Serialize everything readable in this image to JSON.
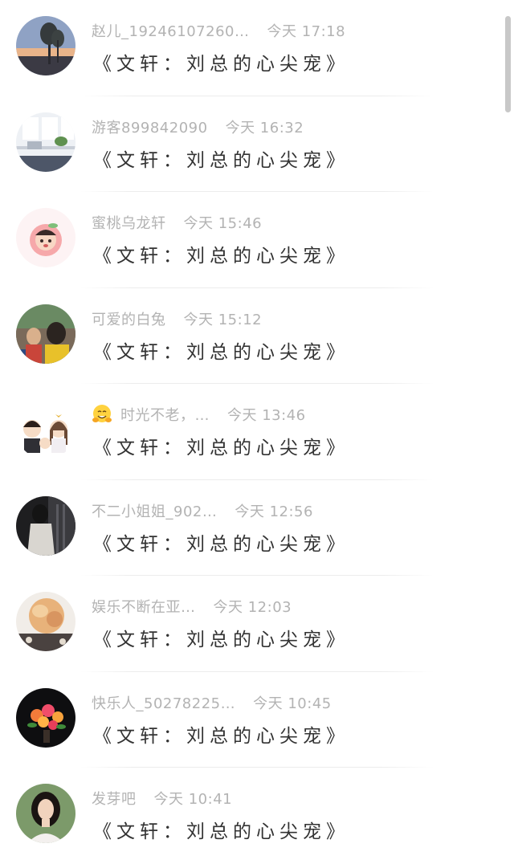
{
  "comments": [
    {
      "name": "赵儿_19246107260…",
      "time": "今天 17:18",
      "message": "《文轩：刘总的心尖宠》",
      "avatar": "trees-sunset-avatar",
      "emoji": ""
    },
    {
      "name": "游客899842090",
      "time": "今天 16:32",
      "message": "《文轩：刘总的心尖宠》",
      "avatar": "room-interior-avatar",
      "emoji": ""
    },
    {
      "name": "蜜桃乌龙轩",
      "time": "今天 15:46",
      "message": "《文轩：刘总的心尖宠》",
      "avatar": "peach-cartoon-avatar",
      "emoji": ""
    },
    {
      "name": "可爱的白兔",
      "time": "今天 15:12",
      "message": "《文轩：刘总的心尖宠》",
      "avatar": "people-photo-avatar",
      "emoji": ""
    },
    {
      "name": "时光不老，…",
      "time": "今天 13:46",
      "message": "《文轩：刘总的心尖宠》",
      "avatar": "cartoon-couple-avatar",
      "emoji": "hugging-face-emoji"
    },
    {
      "name": "不二小姐姐_902…",
      "time": "今天 12:56",
      "message": "《文轩：刘总的心尖宠》",
      "avatar": "dark-photo-avatar",
      "emoji": ""
    },
    {
      "name": "娱乐不断在亚…",
      "time": "今天 12:03",
      "message": "《文轩：刘总的心尖宠》",
      "avatar": "blonde-hair-avatar",
      "emoji": ""
    },
    {
      "name": "快乐人_50278225…",
      "time": "今天 10:45",
      "message": "《文轩：刘总的心尖宠》",
      "avatar": "flower-bouquet-avatar",
      "emoji": ""
    },
    {
      "name": "发芽吧",
      "time": "今天 10:41",
      "message": "《文轩：刘总的心尖宠》",
      "avatar": "girl-portrait-avatar",
      "emoji": ""
    }
  ],
  "colors": {
    "name_time": "#b3b3b3",
    "message": "#333333",
    "divider": "#ececec",
    "scrollbar": "#c8c8c8"
  }
}
